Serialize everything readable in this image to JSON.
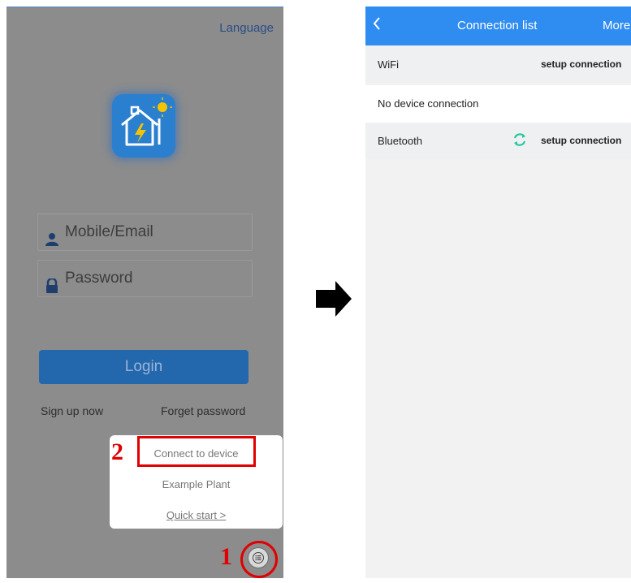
{
  "login_screen": {
    "language_link": "Language",
    "username_placeholder": "Mobile/Email",
    "password_placeholder": "Password",
    "login_button": "Login",
    "sign_up_link": "Sign up now",
    "forget_password_link": "Forget password",
    "popup_menu": {
      "items": [
        "Connect to device",
        "Example Plant",
        "Quick start >"
      ]
    }
  },
  "annotations": {
    "step_1": "1",
    "step_2": "2",
    "color": "#e00000"
  },
  "connection_screen": {
    "title": "Connection list",
    "more": "More",
    "rows": [
      {
        "label": "WiFi",
        "action": "setup connection"
      },
      {
        "label": "No device connection"
      },
      {
        "label": "Bluetooth",
        "action": "setup connection"
      }
    ]
  },
  "icons": [
    "app-logo-icon",
    "user-icon",
    "lock-icon",
    "menu-list-icon",
    "right-arrow-icon",
    "back-chevron-icon",
    "refresh-icon"
  ],
  "colors": {
    "accent_blue": "#2f8cf0",
    "dimmed_overlay": "#8c8c8c",
    "login_button": "#2367ad",
    "refresh_green": "#22c9a0"
  }
}
